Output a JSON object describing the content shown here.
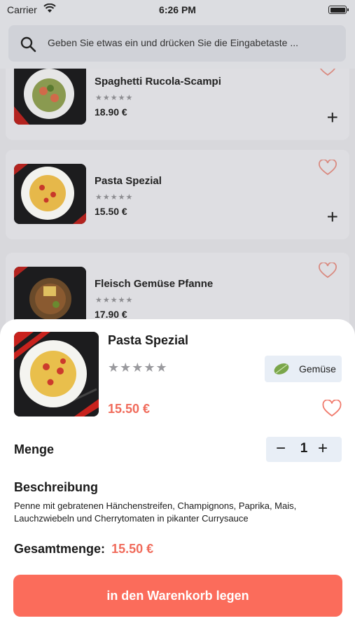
{
  "status_bar": {
    "carrier": "Carrier",
    "time": "6:26 PM"
  },
  "search": {
    "placeholder": "Geben Sie etwas ein und drücken Sie die Eingabetaste ..."
  },
  "list": {
    "items": [
      {
        "name": "Spaghetti Rucola-Scampi",
        "stars": "★★★★★",
        "price": "18.90 €"
      },
      {
        "name": "Pasta Spezial",
        "stars": "★★★★★",
        "price": "15.50 €"
      },
      {
        "name": "Fleisch Gemüse Pfanne",
        "stars": "★★★★★",
        "price": "17.90 €"
      }
    ],
    "add_symbol": "+"
  },
  "detail": {
    "title": "Pasta Spezial",
    "stars": "★★★★★",
    "category": "Gemüse",
    "price": "15.50 €",
    "quantity_label": "Menge",
    "quantity": "1",
    "minus_symbol": "−",
    "plus_symbol": "+",
    "description_label": "Beschreibung",
    "description": "Penne mit gebratenen Hänchenstreifen, Champignons, Paprika, Mais, Lauchzwiebeln und Cherrytomaten in pikanter Currysauce",
    "total_label": "Gesamtmenge:",
    "total_value": "15.50 €",
    "cart_button": "in den Warenkorb legen"
  },
  "colors": {
    "accent": "#fb6c5b",
    "price": "#f06b5b",
    "chip_bg": "#e8eef6"
  }
}
